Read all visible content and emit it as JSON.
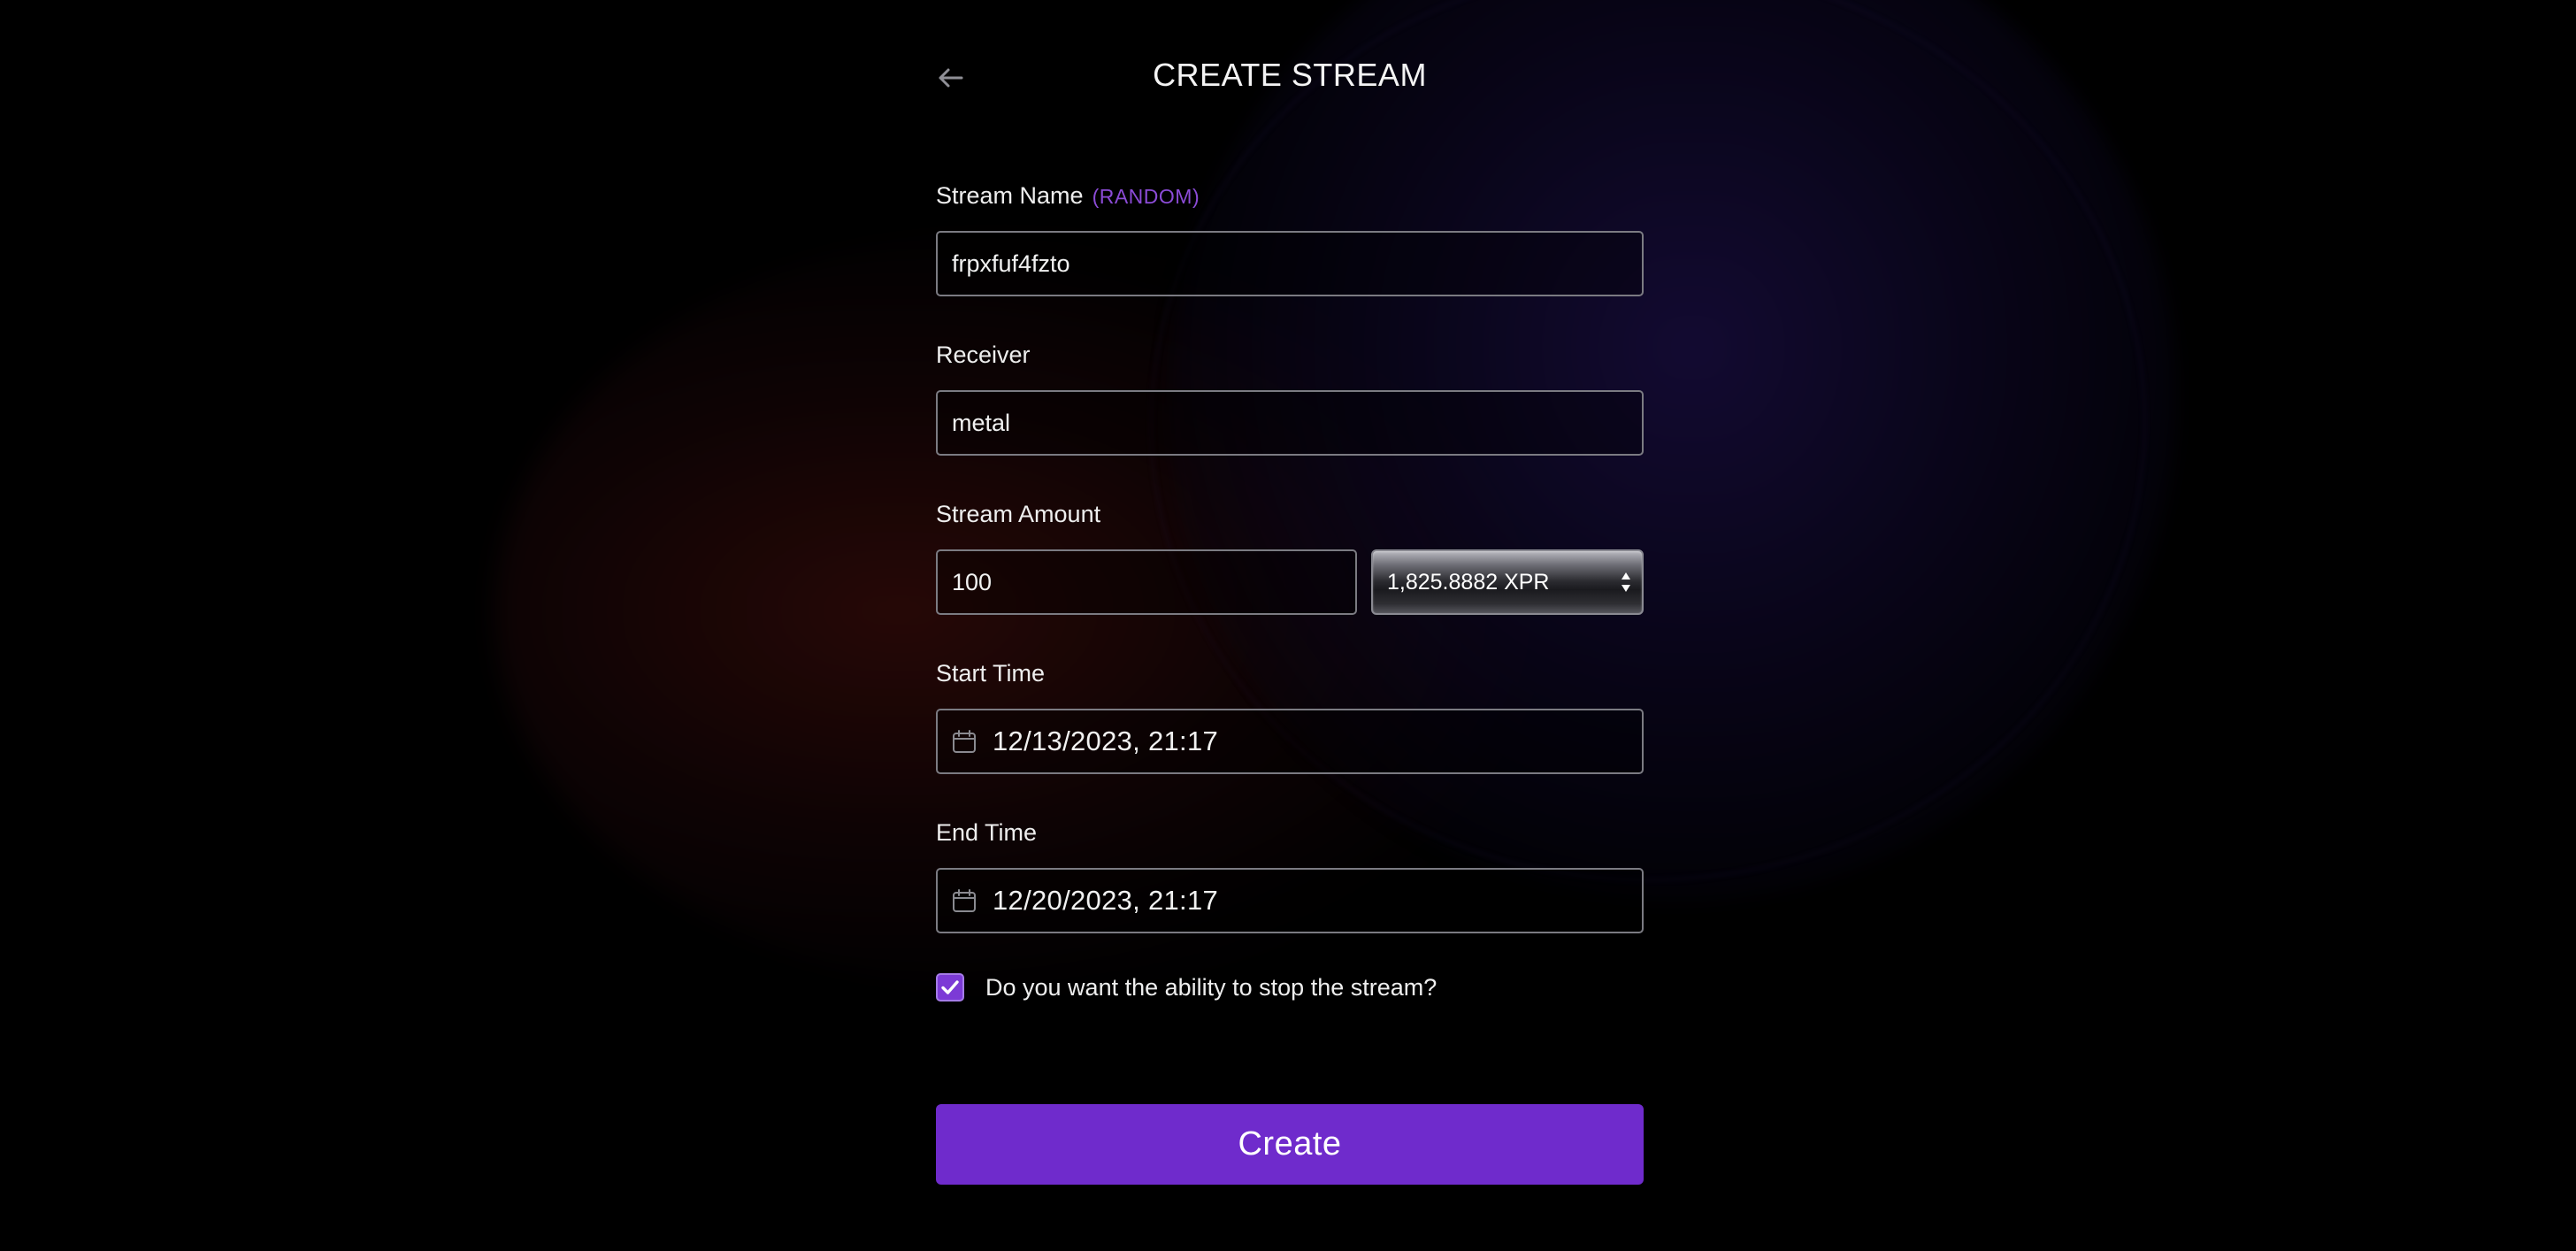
{
  "header": {
    "title": "CREATE STREAM",
    "back_icon": "arrow-left-icon"
  },
  "form": {
    "stream_name": {
      "label": "Stream Name",
      "random_label": "(RANDOM)",
      "value": "frpxfuf4fzto"
    },
    "receiver": {
      "label": "Receiver",
      "value": "metal"
    },
    "stream_amount": {
      "label": "Stream Amount",
      "value": "100",
      "token_selected": "1,825.8882 XPR",
      "token_icon": "select-arrows-icon"
    },
    "start_time": {
      "label": "Start Time",
      "value": "12/13/2023, 21:17",
      "icon": "calendar-icon"
    },
    "end_time": {
      "label": "End Time",
      "value": "12/20/2023, 21:17",
      "icon": "calendar-icon"
    },
    "stop_option": {
      "label": "Do you want the ability to stop the stream?",
      "checked": true
    },
    "submit_label": "Create"
  },
  "colors": {
    "accent": "#6f2bcc",
    "random_tag": "#8b4bd6",
    "background": "#000000",
    "input_border": "#7b7b82"
  }
}
